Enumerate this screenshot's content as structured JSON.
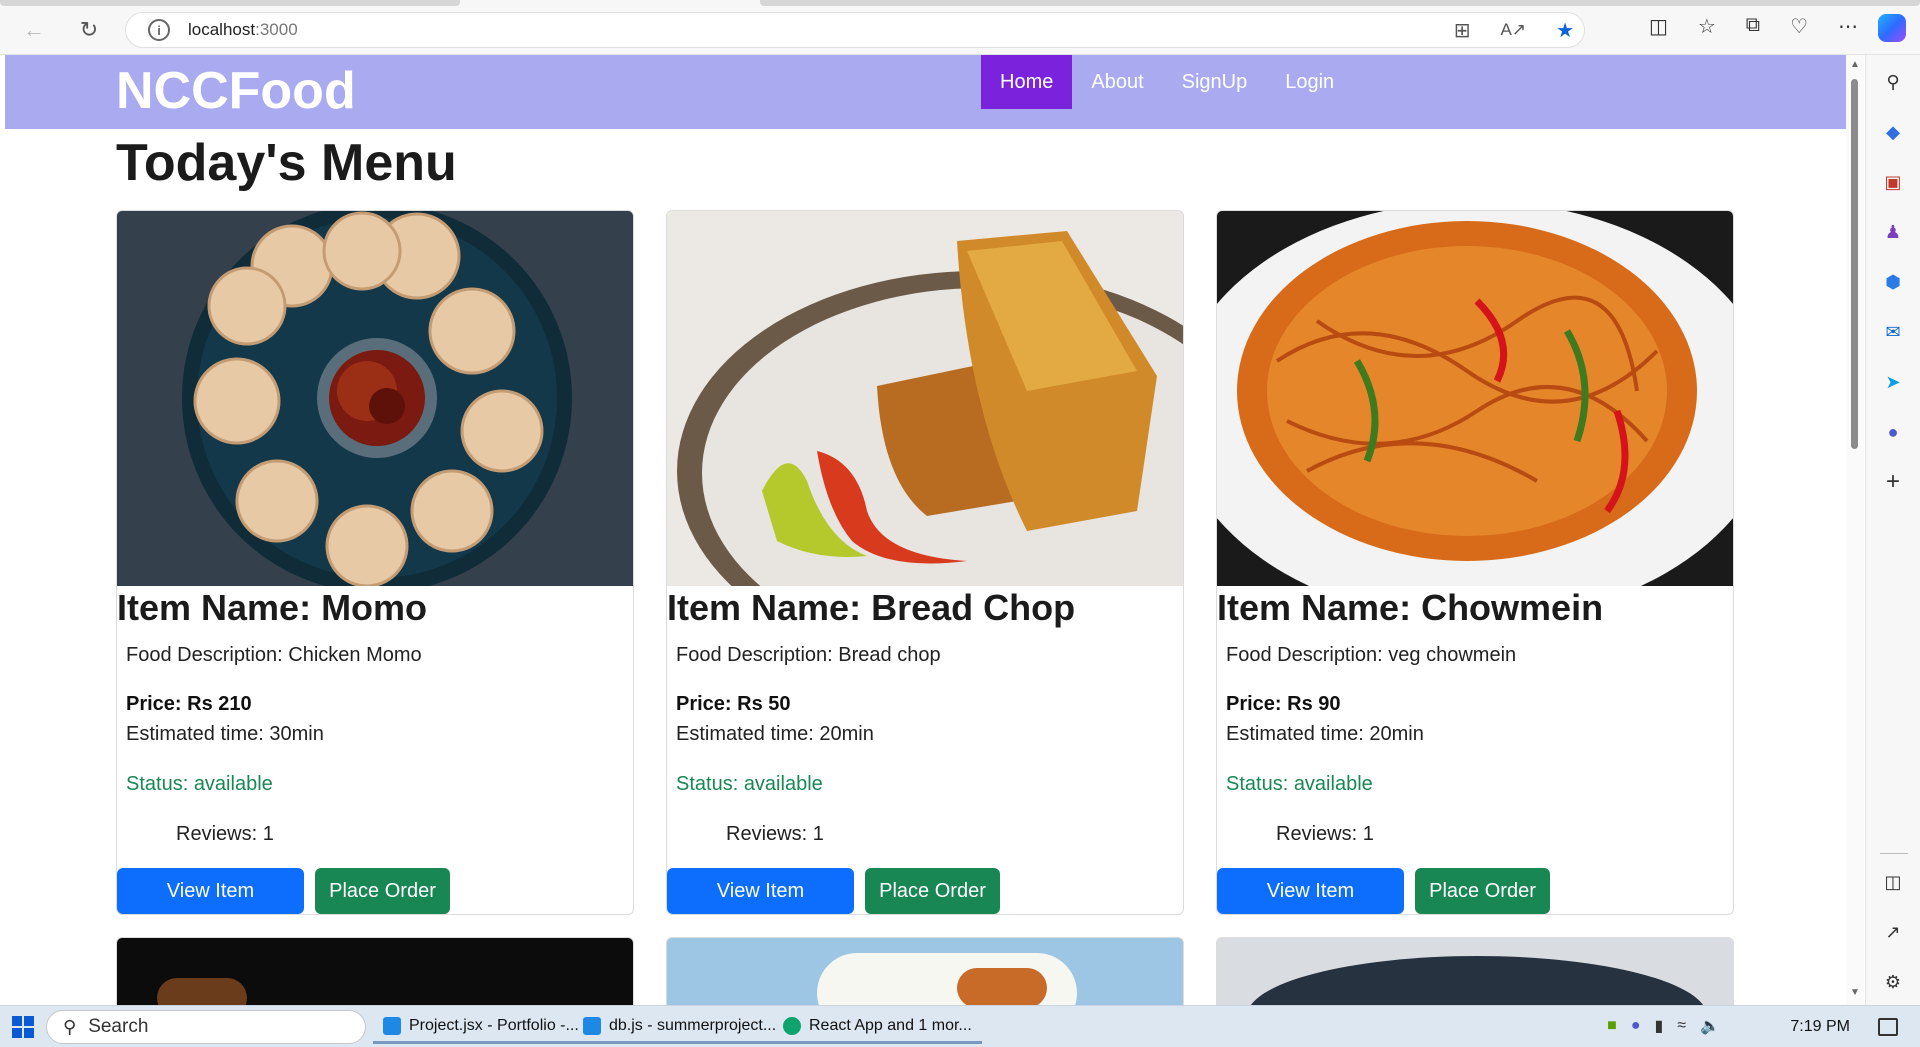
{
  "browser": {
    "url_host": "localhost",
    "url_port": ":3000"
  },
  "navbar": {
    "brand": "NCCFood",
    "links": [
      {
        "label": "Home",
        "active": true
      },
      {
        "label": "About",
        "active": false
      },
      {
        "label": "SignUp",
        "active": false
      },
      {
        "label": "Login",
        "active": false
      }
    ]
  },
  "main": {
    "title": "Today's Menu",
    "cards": [
      {
        "name": "Item Name: Momo",
        "description": "Food Description: Chicken Momo",
        "price": "Price: Rs 210",
        "time": "Estimated time: 30min",
        "status": "Status: available",
        "reviews": "Reviews: 1",
        "view_label": "View Item",
        "order_label": "Place Order"
      },
      {
        "name": "Item Name: Bread Chop",
        "description": "Food Description: Bread chop",
        "price": "Price: Rs 50",
        "time": "Estimated time: 20min",
        "status": "Status: available",
        "reviews": "Reviews: 1",
        "view_label": "View Item",
        "order_label": "Place Order"
      },
      {
        "name": "Item Name: Chowmein",
        "description": "Food Description: veg chowmein",
        "price": "Price: Rs 90",
        "time": "Estimated time: 20min",
        "status": "Status: available",
        "reviews": "Reviews: 1",
        "view_label": "View Item",
        "order_label": "Place Order"
      }
    ]
  },
  "taskbar": {
    "search_label": "Search",
    "apps": [
      {
        "label": "Project.jsx - Portfolio -..."
      },
      {
        "label": "db.js - summerproject..."
      },
      {
        "label": "React App and 1 mor..."
      }
    ],
    "time": "7:19 PM"
  },
  "colors": {
    "navbar": "#a9aaf0",
    "active_nav": "#7b22dd",
    "primary_button": "#0d6efd",
    "success": "#198754"
  }
}
